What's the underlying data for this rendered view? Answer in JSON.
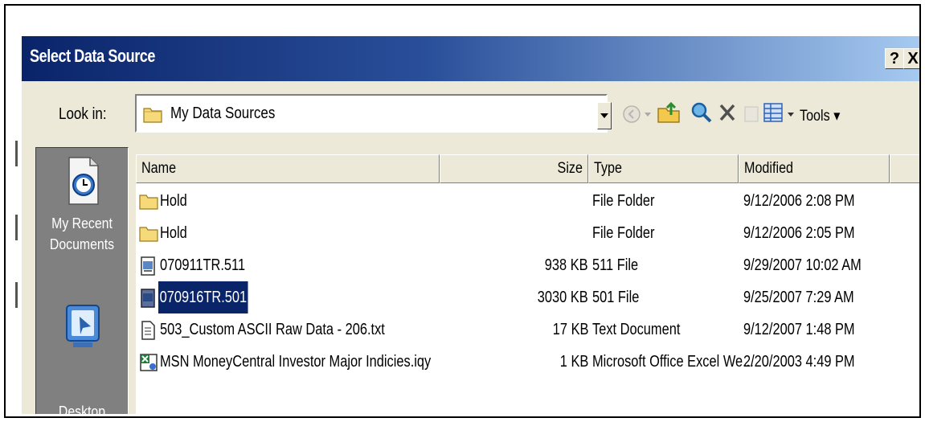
{
  "dialog": {
    "title": "Select Data Source",
    "help_label": "?",
    "close_label": "X"
  },
  "toolbar": {
    "look_in_label": "Look in:",
    "look_in_value": "My Data Sources",
    "tools_label": "Tools ▾"
  },
  "places": [
    {
      "label_line1": "My Recent",
      "label_line2": "Documents",
      "icon": "recent-documents-icon"
    },
    {
      "label_line1": "Desktop",
      "label_line2": "",
      "icon": "desktop-icon"
    }
  ],
  "columns": {
    "name": "Name",
    "size": "Size",
    "type": "Type",
    "modified": "Modified"
  },
  "files": [
    {
      "name": "Hold",
      "size": "",
      "type": "File Folder",
      "modified": "9/12/2006 2:08 PM",
      "icon": "folder-icon",
      "selected": false
    },
    {
      "name": "Hold",
      "size": "",
      "type": "File Folder",
      "modified": "9/12/2006 2:05 PM",
      "icon": "folder-icon",
      "selected": false
    },
    {
      "name": "070911TR.511",
      "size": "938 KB",
      "type": "511 File",
      "modified": "9/29/2007 10:02 AM",
      "icon": "data-file-icon",
      "selected": false
    },
    {
      "name": "070916TR.501",
      "size": "3030 KB",
      "type": "501 File",
      "modified": "9/25/2007 7:29 AM",
      "icon": "data-file-icon",
      "selected": true
    },
    {
      "name": "503_Custom ASCII Raw Data - 206.txt",
      "size": "17 KB",
      "type": "Text Document",
      "modified": "9/12/2007 1:48 PM",
      "icon": "text-file-icon",
      "selected": false
    },
    {
      "name": "MSN MoneyCentral Investor Major Indicies.iqy",
      "size": "1 KB",
      "type": "Microsoft Office Excel We...",
      "modified": "2/20/2003 4:49 PM",
      "icon": "excel-query-icon",
      "selected": false
    }
  ],
  "colors": {
    "title_gradient_start": "#0a246a",
    "title_gradient_end": "#a6caf0",
    "dialog_face": "#ece9d8",
    "selection": "#0a246a"
  }
}
